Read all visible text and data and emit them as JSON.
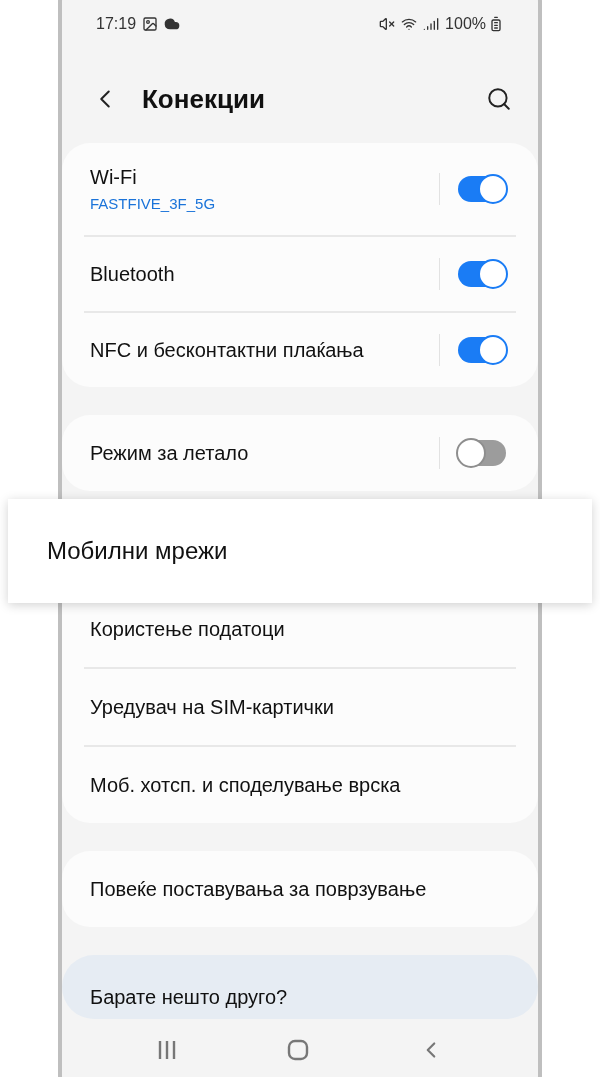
{
  "status_bar": {
    "time": "17:19",
    "battery": "100%"
  },
  "header": {
    "title": "Конекции"
  },
  "groups": [
    {
      "rows": [
        {
          "label": "Wi-Fi",
          "subtitle": "FASTFIVE_3F_5G",
          "kind": "toggle",
          "on": true
        },
        {
          "label": "Bluetooth",
          "kind": "toggle",
          "on": true
        },
        {
          "label": "NFC и бесконтактни плаќања",
          "kind": "toggle",
          "on": true
        }
      ]
    },
    {
      "rows": [
        {
          "label": "Режим за летало",
          "kind": "toggle",
          "on": false
        }
      ]
    },
    {
      "rows": [
        {
          "label": "Мобилни мрежи",
          "kind": "highlight"
        },
        {
          "label": "Користење податоци",
          "kind": "link"
        },
        {
          "label": "Уредувач на SIM-картички",
          "kind": "link"
        },
        {
          "label": "Моб. хотсп. и споделување врска",
          "kind": "link"
        }
      ]
    },
    {
      "rows": [
        {
          "label": "Повеќе поставувања за поврзување",
          "kind": "link"
        }
      ]
    }
  ],
  "suggestion": {
    "label": "Барате нешто друго?"
  }
}
